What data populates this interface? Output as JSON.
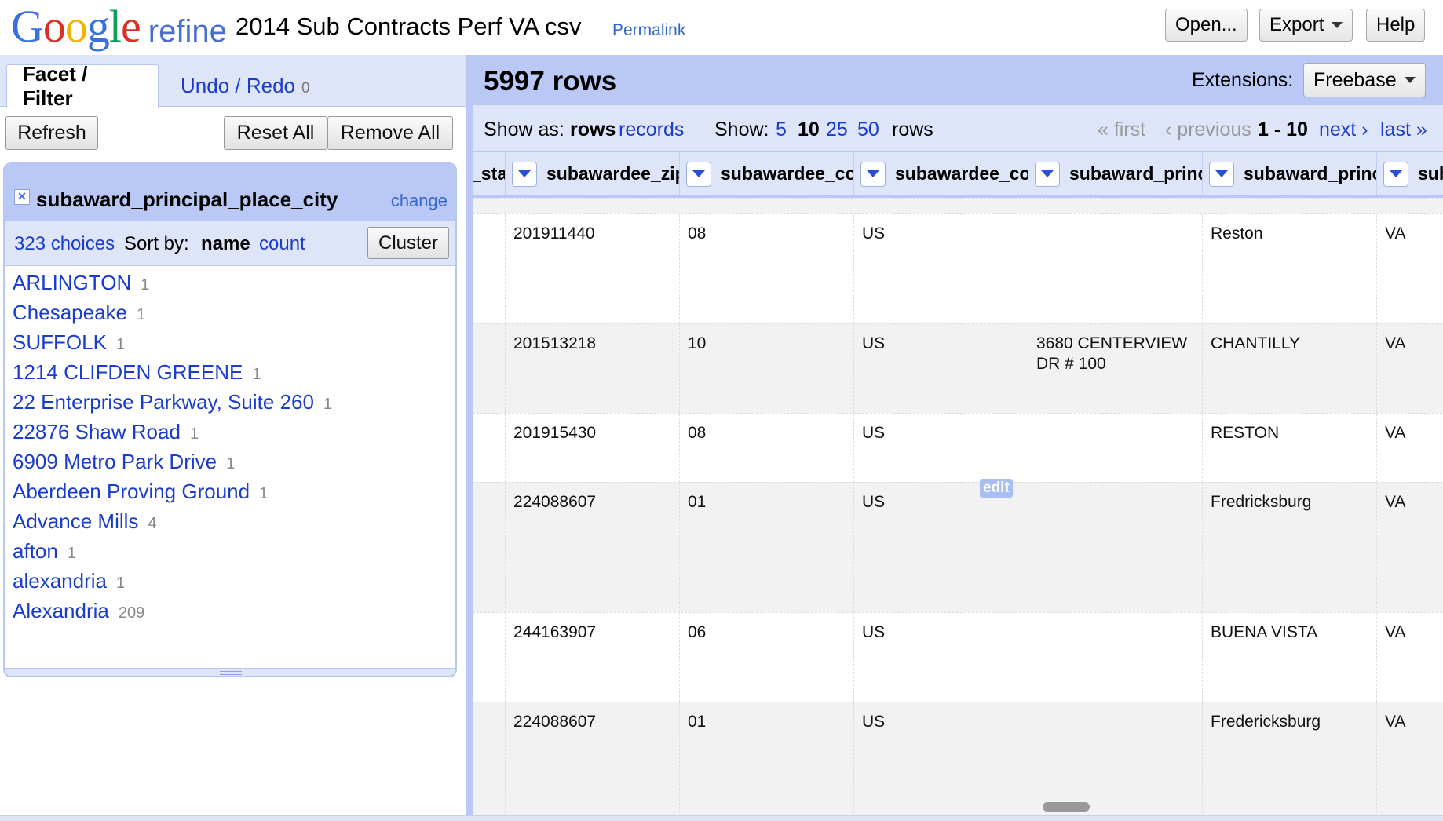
{
  "header": {
    "logo_google": "Google",
    "logo_refine": "refine",
    "project_title": "2014 Sub Contracts Perf VA csv",
    "permalink": "Permalink",
    "buttons": {
      "open": "Open...",
      "export": "Export",
      "help": "Help"
    }
  },
  "left_panel": {
    "tabs": {
      "facet_filter": "Facet / Filter",
      "undo_redo": "Undo / Redo",
      "undo_count": "0"
    },
    "buttons": {
      "refresh": "Refresh",
      "reset_all": "Reset All",
      "remove_all": "Remove All"
    },
    "facet": {
      "title": "subaward_principal_place_city",
      "change": "change",
      "choices_count": "323 choices",
      "sort_by": "Sort by:",
      "sort_name": "name",
      "sort_count": "count",
      "cluster": "Cluster",
      "items": [
        {
          "label": "ARLINGTON",
          "count": "1"
        },
        {
          "label": "Chesapeake",
          "count": "1"
        },
        {
          "label": "SUFFOLK",
          "count": "1"
        },
        {
          "label": "1214 CLIFDEN GREENE",
          "count": "1"
        },
        {
          "label": "22 Enterprise Parkway, Suite 260",
          "count": "1"
        },
        {
          "label": "22876 Shaw Road",
          "count": "1"
        },
        {
          "label": "6909 Metro Park Drive",
          "count": "1"
        },
        {
          "label": "Aberdeen Proving Ground",
          "count": "1"
        },
        {
          "label": "Advance Mills",
          "count": "4"
        },
        {
          "label": "afton",
          "count": "1"
        },
        {
          "label": "alexandria",
          "count": "1"
        },
        {
          "label": "Alexandria",
          "count": "209"
        }
      ]
    }
  },
  "right_panel": {
    "row_count": "5997 rows",
    "extensions_label": "Extensions:",
    "extensions_value": "Freebase",
    "view": {
      "show_as": "Show as:",
      "rows": "rows",
      "records": "records",
      "show": "Show:",
      "sizes": [
        "5",
        "10",
        "25",
        "50"
      ],
      "rows_suffix": "rows",
      "first": "« first",
      "previous": "‹ previous",
      "range": "1 - 10",
      "next": "next ›",
      "last": "last »"
    },
    "columns": [
      "_sta",
      "subawardee_zip",
      "subawardee_congressional_district",
      "subawardee_country",
      "subaward_principal_place_street",
      "subaward_principal_place_city",
      "subaward_principal_place_state"
    ],
    "rows": [
      [
        "",
        "201911440",
        "08",
        "US",
        "",
        "Reston",
        "VA"
      ],
      [
        "",
        "201513218",
        "10",
        "US",
        "3680 CENTERVIEW DR # 100",
        "CHANTILLY",
        "VA"
      ],
      [
        "",
        "201915430",
        "08",
        "US",
        "",
        "RESTON",
        "VA"
      ],
      [
        "",
        "224088607",
        "01",
        "US",
        "",
        "Fredricksburg",
        "VA"
      ],
      [
        "",
        "244163907",
        "06",
        "US",
        "",
        "BUENA VISTA",
        "VA"
      ],
      [
        "",
        "224088607",
        "01",
        "US",
        "",
        "Fredericksburg",
        "VA"
      ]
    ],
    "edit_label": "edit"
  }
}
